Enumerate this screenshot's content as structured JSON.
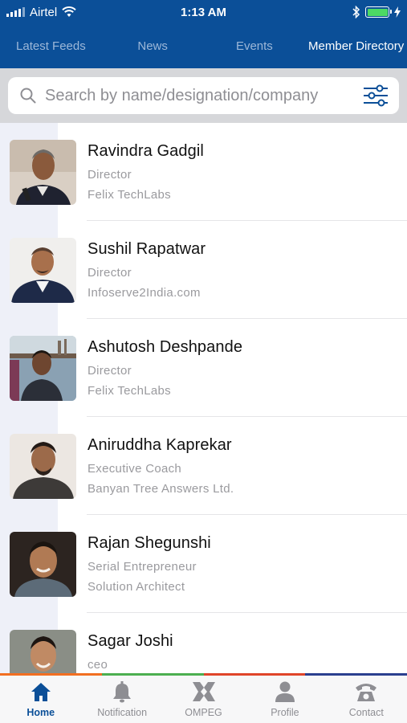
{
  "status_bar": {
    "carrier": "Airtel",
    "time": "1:13 AM"
  },
  "tabs": [
    {
      "label": "Latest Feeds",
      "active": false
    },
    {
      "label": "News",
      "active": false
    },
    {
      "label": "Events",
      "active": false
    },
    {
      "label": "Member Directory",
      "active": true
    }
  ],
  "search": {
    "placeholder": "Search by name/designation/company"
  },
  "members": [
    {
      "name": "Ravindra Gadgil",
      "designation": "Director",
      "company": "Felix TechLabs"
    },
    {
      "name": "Sushil Rapatwar",
      "designation": "Director",
      "company": " Infoserve2India.com"
    },
    {
      "name": "Ashutosh Deshpande",
      "designation": "Director",
      "company": "Felix TechLabs"
    },
    {
      "name": "Aniruddha Kaprekar",
      "designation": "Executive Coach",
      "company": "Banyan Tree Answers Ltd."
    },
    {
      "name": "Rajan Shegunshi",
      "designation": "Serial Entrepreneur",
      "company": "Solution Architect"
    },
    {
      "name": "Sagar Joshi",
      "designation": "ceo",
      "company": ""
    }
  ],
  "bottom_nav": [
    {
      "label": "Home",
      "icon": "home-icon",
      "active": true
    },
    {
      "label": "Notification",
      "icon": "bell-icon",
      "active": false
    },
    {
      "label": "OMPEG",
      "icon": "ompeg-logo-icon",
      "active": false
    },
    {
      "label": "Profile",
      "icon": "person-icon",
      "active": false
    },
    {
      "label": "Contact",
      "icon": "phone-icon",
      "active": false
    }
  ],
  "colors": {
    "primary": "#0b4f98",
    "strip": [
      "#f26f21",
      "#4caf50",
      "#e0452a",
      "#2a3f8f"
    ]
  }
}
